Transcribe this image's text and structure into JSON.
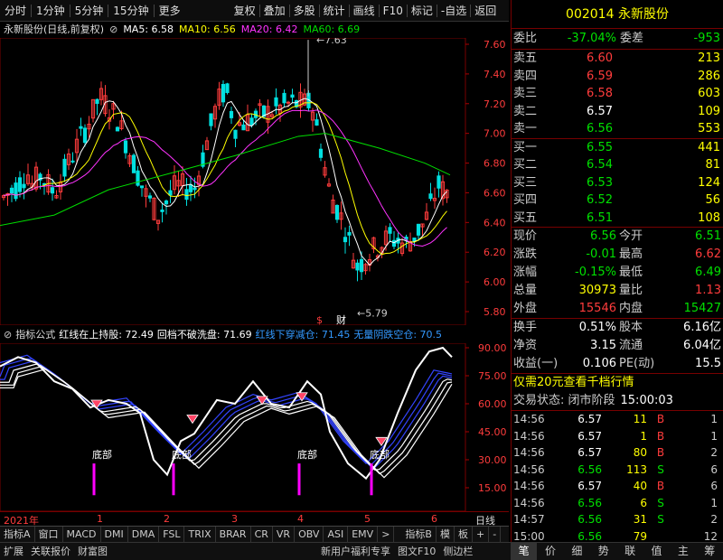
{
  "toolbar": {
    "left_items": [
      "分时",
      "1分钟",
      "5分钟",
      "15分钟",
      "更多"
    ],
    "right_items": [
      "复权",
      "叠加",
      "多股",
      "统计",
      "画线",
      "F10",
      "标记",
      "-自选",
      "返回"
    ]
  },
  "stock_title": {
    "name": "永新股份(日线,前复权)",
    "ma5": "MA5: 6.58",
    "ma10": "MA10: 6.56",
    "ma20": "MA20: 6.42",
    "ma60": "MA60: 6.69",
    "colors": {
      "ma5": "#ffffff",
      "ma10": "#ffff00",
      "ma20": "#ff33ff",
      "ma60": "#00dd00"
    }
  },
  "main_chart": {
    "y_ticks": [
      "7.60",
      "7.40",
      "7.20",
      "7.00",
      "6.80",
      "6.60",
      "6.40",
      "6.20",
      "6.00",
      "5.80"
    ],
    "high_label": "7.63",
    "low_label": "5.79",
    "markers": [
      "$",
      "财"
    ]
  },
  "indicator": {
    "name": "指标公式",
    "items": [
      {
        "text": "红线在上持股: 72.49",
        "color": "#ffffff"
      },
      {
        "text": "回档不破洗盘: 71.69",
        "color": "#ffffff"
      },
      {
        "text": "红线下穿减仓: 71.45",
        "color": "#3399ff"
      },
      {
        "text": "无量阴跌空仓: 70.5",
        "color": "#3399ff"
      }
    ],
    "y_ticks": [
      "90.00",
      "75.00",
      "60.00",
      "45.00",
      "30.00",
      "15.00"
    ],
    "bottom_labels": [
      "底部",
      "底部",
      "底部",
      "底部"
    ]
  },
  "date_axis": {
    "labels": [
      "2021年",
      "1",
      "2",
      "3",
      "4",
      "5",
      "6"
    ],
    "right": "日线"
  },
  "tabs_row1": [
    "指标A",
    "窗口",
    "MACD",
    "DMI",
    "DMA",
    "FSL",
    "TRIX",
    "BRAR",
    "CR",
    "VR",
    "OBV",
    "ASI",
    "EMV",
    ">",
    "指标B",
    "模",
    "板",
    "+",
    "-"
  ],
  "tabs_row2_left": [
    "扩展",
    "关联报价",
    "财富图"
  ],
  "tabs_row2_mid": [
    "新用户福利专享",
    "图文F10",
    "侧边栏"
  ],
  "right_panel": {
    "code": "002014",
    "name": "永新股份",
    "webi": {
      "label": "委比",
      "value": "-37.04%",
      "label2": "委差",
      "value2": "-953"
    },
    "asks": [
      {
        "label": "卖五",
        "price": "6.60",
        "vol": "213"
      },
      {
        "label": "卖四",
        "price": "6.59",
        "vol": "286"
      },
      {
        "label": "卖三",
        "price": "6.58",
        "vol": "603"
      },
      {
        "label": "卖二",
        "price": "6.57",
        "vol": "109"
      },
      {
        "label": "卖一",
        "price": "6.56",
        "vol": "553"
      }
    ],
    "bids": [
      {
        "label": "买一",
        "price": "6.55",
        "vol": "441"
      },
      {
        "label": "买二",
        "price": "6.54",
        "vol": "81"
      },
      {
        "label": "买三",
        "price": "6.53",
        "vol": "124"
      },
      {
        "label": "买四",
        "price": "6.52",
        "vol": "56"
      },
      {
        "label": "买五",
        "price": "6.51",
        "vol": "108"
      }
    ],
    "quote": [
      {
        "l1": "现价",
        "v1": "6.56",
        "l2": "今开",
        "v2": "6.51"
      },
      {
        "l1": "涨跌",
        "v1": "-0.01",
        "l2": "最高",
        "v2": "6.62"
      },
      {
        "l1": "涨幅",
        "v1": "-0.15%",
        "l2": "最低",
        "v2": "6.49"
      },
      {
        "l1": "总量",
        "v1": "30973",
        "l2": "量比",
        "v2": "1.13"
      },
      {
        "l1": "外盘",
        "v1": "15546",
        "l2": "内盘",
        "v2": "15427"
      }
    ],
    "stats": [
      {
        "l1": "换手",
        "v1": "0.51%",
        "l2": "股本",
        "v2": "6.16亿"
      },
      {
        "l1": "净资",
        "v1": "3.15",
        "l2": "流通",
        "v2": "6.04亿"
      },
      {
        "l1": "收益(一)",
        "v1": "0.106",
        "l2": "PE(动)",
        "v2": "15.5"
      }
    ],
    "promo": "仅需20元查看千档行情",
    "status_label": "交易状态: 闭市阶段",
    "status_time": "15:00:03",
    "ticks": [
      {
        "t": "14:56",
        "p": "6.57",
        "v": "11",
        "bs": "B",
        "n": "1"
      },
      {
        "t": "14:56",
        "p": "6.57",
        "v": "1",
        "bs": "B",
        "n": "1"
      },
      {
        "t": "14:56",
        "p": "6.57",
        "v": "80",
        "bs": "B",
        "n": "2"
      },
      {
        "t": "14:56",
        "p": "6.56",
        "v": "113",
        "bs": "S",
        "n": "6"
      },
      {
        "t": "14:56",
        "p": "6.57",
        "v": "40",
        "bs": "B",
        "n": "6"
      },
      {
        "t": "14:56",
        "p": "6.56",
        "v": "6",
        "bs": "S",
        "n": "1"
      },
      {
        "t": "14:57",
        "p": "6.56",
        "v": "31",
        "bs": "S",
        "n": "2"
      },
      {
        "t": "15:00",
        "p": "6.56",
        "v": "79",
        "bs": "",
        "n": "12"
      }
    ],
    "bottom_tabs": [
      "笔",
      "价",
      "细",
      "势",
      "联",
      "值",
      "主",
      "筹"
    ]
  }
}
